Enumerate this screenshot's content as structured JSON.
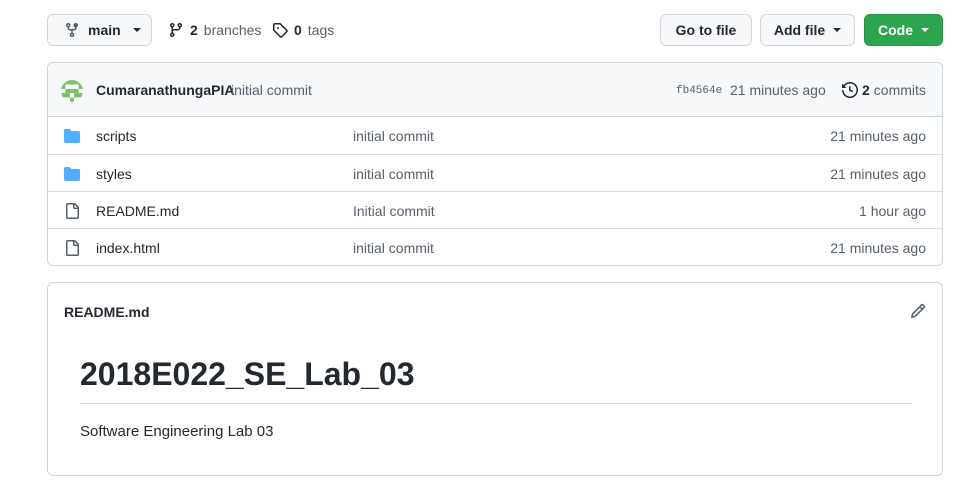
{
  "topbar": {
    "branch": "main",
    "branches_count": "2",
    "branches_label": "branches",
    "tags_count": "0",
    "tags_label": "tags",
    "goto_file": "Go to file",
    "add_file": "Add file",
    "code": "Code"
  },
  "commit": {
    "author": "CumaranathungaPIA",
    "message": "initial commit",
    "sha": "fb4564e",
    "time": "21 minutes ago",
    "commits_count": "2",
    "commits_label": "commits"
  },
  "files": [
    {
      "name": "scripts",
      "type": "folder",
      "message": "initial commit",
      "time": "21 minutes ago"
    },
    {
      "name": "styles",
      "type": "folder",
      "message": "initial commit",
      "time": "21 minutes ago"
    },
    {
      "name": "README.md",
      "type": "file",
      "message": "Initial commit",
      "time": "1 hour ago"
    },
    {
      "name": "index.html",
      "type": "file",
      "message": "initial commit",
      "time": "21 minutes ago"
    }
  ],
  "readme": {
    "filename": "README.md",
    "heading": "2018E022_SE_Lab_03",
    "body": "Software Engineering Lab 03"
  },
  "colors": {
    "folder": "#54aeff",
    "code_button": "#2da44e",
    "avatar": "#7cc46a"
  }
}
